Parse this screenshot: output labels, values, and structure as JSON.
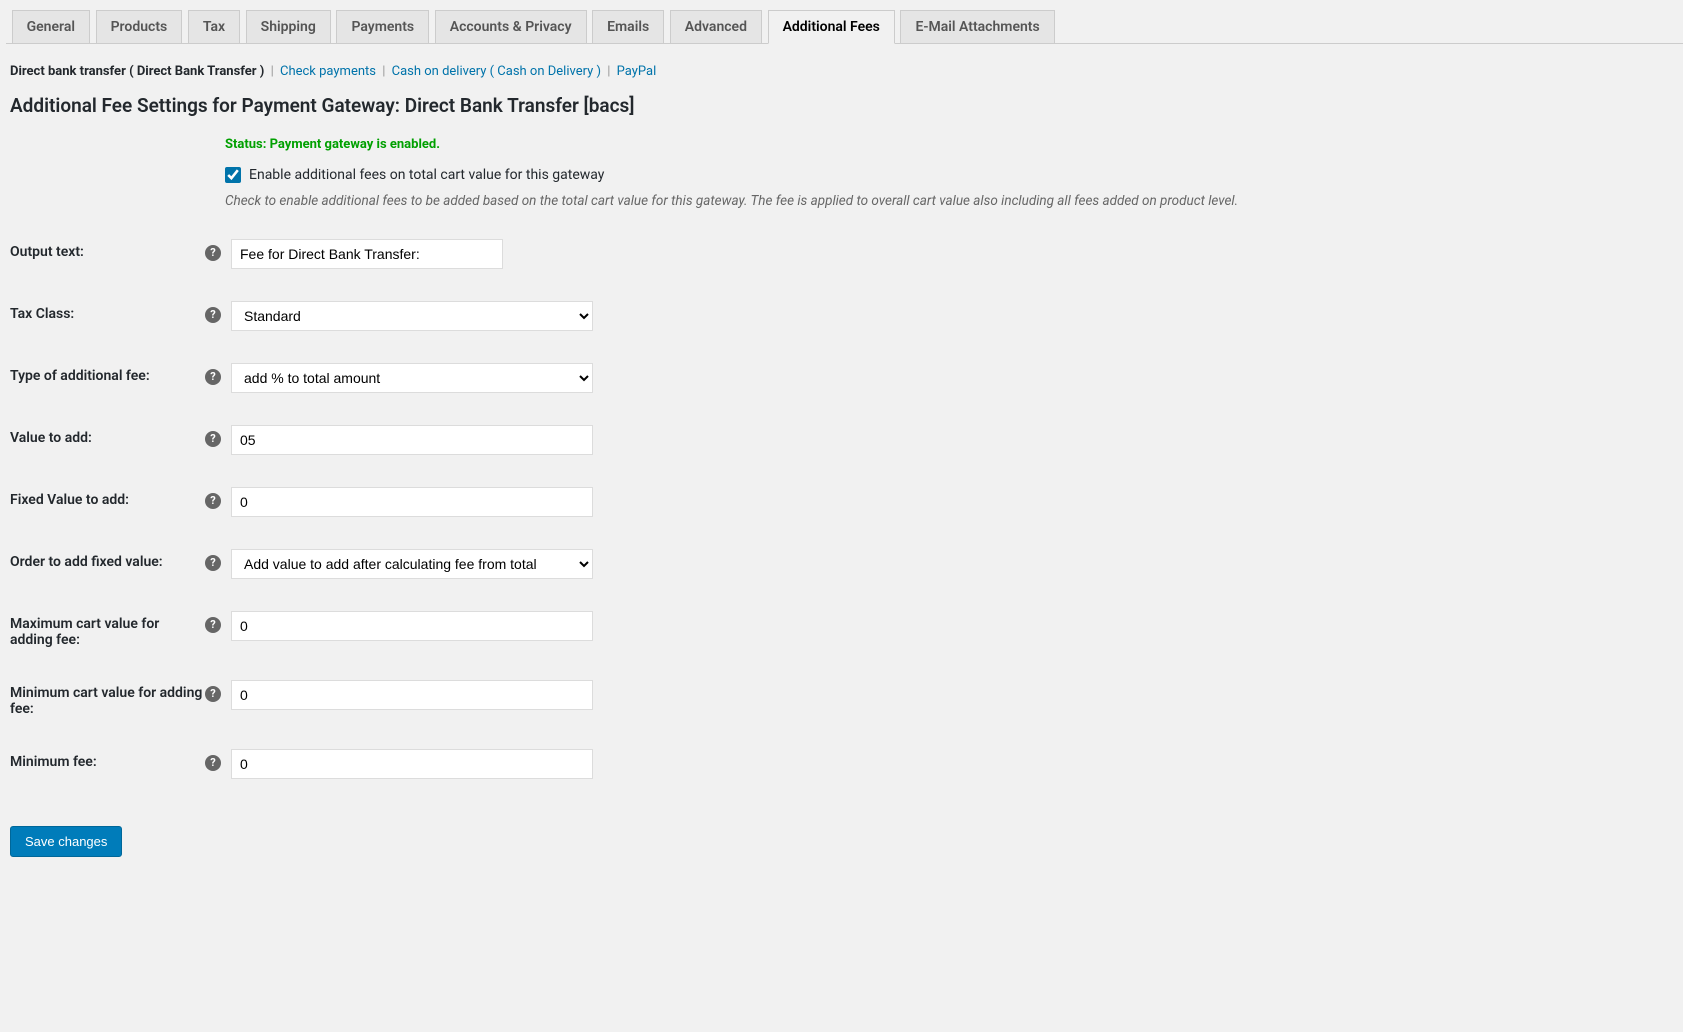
{
  "tabs": [
    {
      "label": "General"
    },
    {
      "label": "Products"
    },
    {
      "label": "Tax"
    },
    {
      "label": "Shipping"
    },
    {
      "label": "Payments"
    },
    {
      "label": "Accounts & Privacy"
    },
    {
      "label": "Emails"
    },
    {
      "label": "Advanced"
    },
    {
      "label": "Additional Fees",
      "active": true
    },
    {
      "label": "E-Mail Attachments"
    }
  ],
  "subnav": {
    "active": "Direct bank transfer ( Direct Bank Transfer )",
    "links": [
      "Check payments",
      "Cash on delivery ( Cash on Delivery )",
      "PayPal"
    ]
  },
  "page_title": "Additional Fee Settings for Payment Gateway: Direct Bank Transfer [bacs]",
  "status": "Status: Payment gateway is enabled.",
  "enable_checkbox": {
    "checked": true,
    "label": "Enable additional fees on total cart value for this gateway"
  },
  "description": "Check to enable additional fees to be added based on the total cart value for this gateway. The fee is applied to overall cart value also including all fees added on product level.",
  "fields": {
    "output_text": {
      "label": "Output text:",
      "value": "Fee for Direct Bank Transfer:"
    },
    "tax_class": {
      "label": "Tax Class:",
      "value": "Standard"
    },
    "fee_type": {
      "label": "Type of additional fee:",
      "value": "add % to total amount"
    },
    "value_add": {
      "label": "Value to add:",
      "value": "05"
    },
    "fixed_value": {
      "label": "Fixed Value to add:",
      "value": "0"
    },
    "order_fixed": {
      "label": "Order to add fixed value:",
      "value": "Add value to add after calculating fee from total"
    },
    "max_cart": {
      "label": "Maximum cart value for adding fee:",
      "value": "0"
    },
    "min_cart": {
      "label": "Minimum cart value for adding fee:",
      "value": "0"
    },
    "min_fee": {
      "label": "Minimum fee:",
      "value": "0"
    }
  },
  "save_button": "Save changes"
}
